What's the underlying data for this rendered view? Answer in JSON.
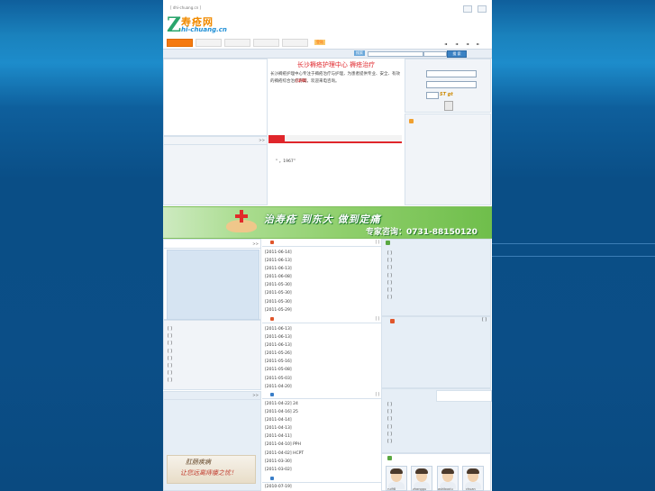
{
  "header": {
    "url_tag": "[ dhi-chuang.cn ]",
    "logo_letter": "Z",
    "logo_cn": "寿疮网",
    "logo_en": "hi-chuang.cn",
    "nav_small": "登陆",
    "arrows": [
      "◄",
      "◄",
      "◄",
      "►"
    ]
  },
  "search": {
    "label": "搜索",
    "button": "搜 索"
  },
  "intro": {
    "title": "长沙褥疮护理中心 褥疮治疗",
    "text": "长沙褥疮护理中心专注于褥疮治疗与护理，为患者提供专业、安全、有效的褥疮综合治疗方案，欢迎来电咨询。",
    "more": "[详细]"
  },
  "news_block": {
    "text": "“  。1967”"
  },
  "banner": {
    "slogan": "治寿疮 到东大 做到定痛",
    "phone": "专家咨询：0731-88150120"
  },
  "list1": {
    "dates": [
      "[2011-06-14]",
      "[2011-06-13]",
      "[2011-06-13]",
      "[2011-06-08]",
      "[2011-05-30]",
      "[2011-05-30]",
      "[2011-05-30]",
      "[2011-05-29]"
    ],
    "more": "[ ]"
  },
  "list2": {
    "dates": [
      "[2011-06-13]",
      "[2011-06-13]",
      "[2011-06-13]",
      "[2011-05-26]",
      "[2011-05-16]",
      "[2011-05-08]",
      "[2011-05-03]",
      "[2011-04-20]"
    ],
    "more": "[ ]"
  },
  "list3": {
    "items": [
      "[2011-04-22] 24",
      "[2011-04-16] 25",
      "[2011-04-14]",
      "[2011-04-13]",
      "[2011-04-11]",
      "[2011-04-10]  PPH",
      "[2011-04-02] HCPT",
      "[2011-03-30]",
      "[2011-03-02]"
    ],
    "more": "[ ]"
  },
  "list4": {
    "dates": [
      "[2010-07-19]"
    ]
  },
  "left_brackets": [
    "[ ]",
    "[ ]",
    "[ ]",
    "[ ]",
    "[ ]",
    "[ ]",
    "[ ]",
    "[ ]"
  ],
  "right_brackets1": [
    "[ ]",
    "[ ]",
    "[ ]",
    "[ ]",
    "[ ]",
    "[ ]",
    "[ ]"
  ],
  "right_brackets2": [
    "[ ]",
    "[ ]",
    "[ ]",
    "[ ]",
    "[ ]",
    "[ ]"
  ],
  "calligraphy": {
    "line1": "肛肠疾病",
    "line2": "让您远离痔瘘之忧！"
  },
  "avatars": [
    "rui98",
    "zhanggu",
    "ashiboxiu",
    "chuan"
  ],
  "more_small": ">>"
}
